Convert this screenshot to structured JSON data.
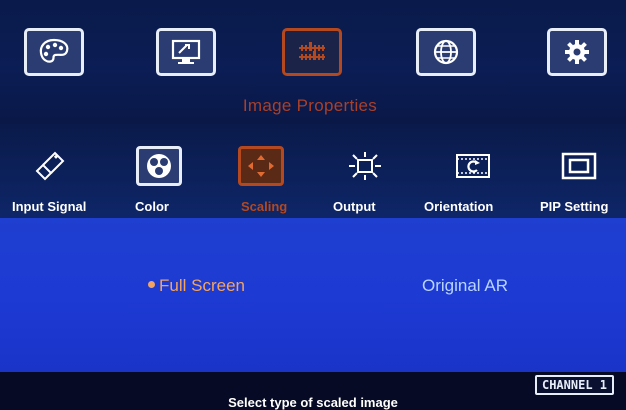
{
  "top_menu": {
    "title": "Image Properties",
    "items": [
      {
        "icon": "palette-icon",
        "selected": false
      },
      {
        "icon": "monitor-settings-icon",
        "selected": false
      },
      {
        "icon": "image-properties-icon",
        "selected": true
      },
      {
        "icon": "globe-icon",
        "selected": false
      },
      {
        "icon": "gear-icon",
        "selected": false
      }
    ]
  },
  "sub_menu": {
    "items": [
      {
        "label": "Input Signal",
        "icon": "usb-plug-icon",
        "selected": false
      },
      {
        "label": "Color",
        "icon": "color-dots-icon",
        "selected": false
      },
      {
        "label": "Scaling",
        "icon": "scaling-arrows-icon",
        "selected": true
      },
      {
        "label": "Output",
        "icon": "output-display-icon",
        "selected": false
      },
      {
        "label": "Orientation",
        "icon": "rotate-icon",
        "selected": false
      },
      {
        "label": "PIP Setting",
        "icon": "pip-window-icon",
        "selected": false
      }
    ]
  },
  "options": {
    "full_screen": "Full Screen",
    "original_ar": "Original AR",
    "selected": "Full Screen"
  },
  "status": {
    "hint": "Select type of scaled image",
    "channel": "CHANNEL 1"
  },
  "colors": {
    "accent": "#b4481e",
    "selected_option": "#f3a460",
    "content_background": "#1f3fd0"
  }
}
